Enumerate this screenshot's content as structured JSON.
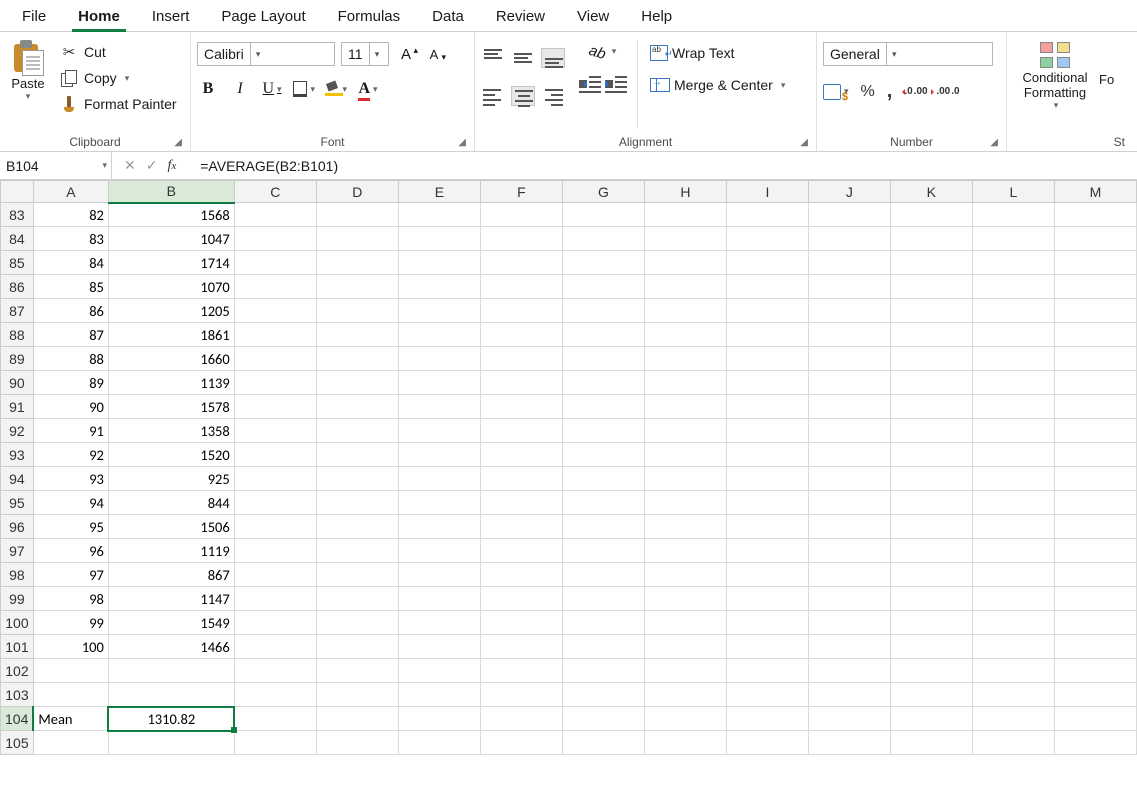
{
  "tabs": [
    "File",
    "Home",
    "Insert",
    "Page Layout",
    "Formulas",
    "Data",
    "Review",
    "View",
    "Help"
  ],
  "active_tab": "Home",
  "ribbon": {
    "clipboard": {
      "paste": "Paste",
      "cut": "Cut",
      "copy": "Copy",
      "format_painter": "Format Painter",
      "group": "Clipboard"
    },
    "font": {
      "name": "Calibri",
      "size": "11",
      "group": "Font"
    },
    "alignment": {
      "wrap": "Wrap Text",
      "merge": "Merge & Center",
      "group": "Alignment"
    },
    "number": {
      "format": "General",
      "group": "Number",
      "percent": "%",
      "comma": ","
    },
    "styles": {
      "conditional_l1": "Conditional",
      "conditional_l2": "Formatting",
      "format_table": "Fo",
      "styles_prefix": "St"
    }
  },
  "name_box": "B104",
  "formula": "=AVERAGE(B2:B101)",
  "columns": [
    "A",
    "B",
    "C",
    "D",
    "E",
    "F",
    "G",
    "H",
    "I",
    "J",
    "K",
    "L",
    "M"
  ],
  "rows": [
    {
      "n": "83",
      "a": "82",
      "b": "1568"
    },
    {
      "n": "84",
      "a": "83",
      "b": "1047"
    },
    {
      "n": "85",
      "a": "84",
      "b": "1714"
    },
    {
      "n": "86",
      "a": "85",
      "b": "1070"
    },
    {
      "n": "87",
      "a": "86",
      "b": "1205"
    },
    {
      "n": "88",
      "a": "87",
      "b": "1861"
    },
    {
      "n": "89",
      "a": "88",
      "b": "1660"
    },
    {
      "n": "90",
      "a": "89",
      "b": "1139"
    },
    {
      "n": "91",
      "a": "90",
      "b": "1578"
    },
    {
      "n": "92",
      "a": "91",
      "b": "1358"
    },
    {
      "n": "93",
      "a": "92",
      "b": "1520"
    },
    {
      "n": "94",
      "a": "93",
      "b": "925"
    },
    {
      "n": "95",
      "a": "94",
      "b": "844"
    },
    {
      "n": "96",
      "a": "95",
      "b": "1506"
    },
    {
      "n": "97",
      "a": "96",
      "b": "1119"
    },
    {
      "n": "98",
      "a": "97",
      "b": "867"
    },
    {
      "n": "99",
      "a": "98",
      "b": "1147"
    },
    {
      "n": "100",
      "a": "99",
      "b": "1549"
    },
    {
      "n": "101",
      "a": "100",
      "b": "1466"
    },
    {
      "n": "102",
      "a": "",
      "b": ""
    },
    {
      "n": "103",
      "a": "",
      "b": ""
    },
    {
      "n": "104",
      "a": "Mean",
      "b": "1310.82",
      "a_align": "left",
      "b_align": "center",
      "active": true
    },
    {
      "n": "105",
      "a": "",
      "b": ""
    }
  ],
  "active_cell": "B104",
  "col_widths": {
    "row": 26,
    "A": 76,
    "B": 128,
    "C": 84,
    "D": 84,
    "E": 84,
    "F": 84,
    "G": 84,
    "H": 84,
    "I": 84,
    "J": 84,
    "K": 84,
    "L": 84,
    "M": 84
  }
}
